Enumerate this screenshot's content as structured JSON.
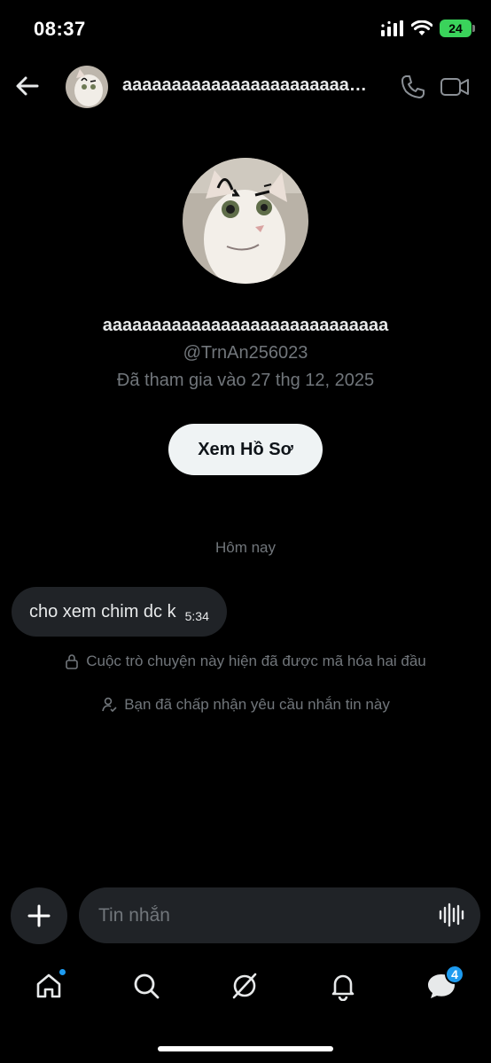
{
  "status_bar": {
    "time": "08:37",
    "battery": "24",
    "icons": [
      "signal-icon",
      "wifi-icon",
      "battery-icon"
    ]
  },
  "header": {
    "back_icon": "back-arrow-icon",
    "name": "aaaaaaaaaaaaaaaaaaaaaaaaaaaaa",
    "call_icon": "phone-icon",
    "video_icon": "video-camera-icon"
  },
  "profile": {
    "name": "aaaaaaaaaaaaaaaaaaaaaaaaaaaaa",
    "handle": "@TrnAn256023",
    "joined": "Đã tham gia vào 27 thg 12, 2025",
    "view_button": "Xem Hồ Sơ"
  },
  "conversation": {
    "date_divider": "Hôm nay",
    "messages": [
      {
        "text": "cho xem chim dc k",
        "time": "5:34"
      }
    ],
    "encryption_note": "Cuộc trò chuyện này hiện đã được mã hóa hai đầu",
    "accepted_note": "Bạn đã chấp nhận yêu cầu nhắn tin này"
  },
  "composer": {
    "placeholder": "Tin nhắn",
    "plus_icon": "plus-icon",
    "voice_icon": "voice-waveform-icon"
  },
  "tab_bar": {
    "tabs": [
      {
        "icon": "home-icon",
        "has_dot": true
      },
      {
        "icon": "search-icon"
      },
      {
        "icon": "grok-icon"
      },
      {
        "icon": "bell-icon"
      },
      {
        "icon": "messages-icon",
        "badge": "4"
      }
    ]
  },
  "colors": {
    "background": "#000000",
    "bubble": "#202327",
    "secondary_text": "#71767b",
    "accent": "#1d9bf0",
    "button_bg": "#eff3f4",
    "battery": "#3ad35b"
  }
}
